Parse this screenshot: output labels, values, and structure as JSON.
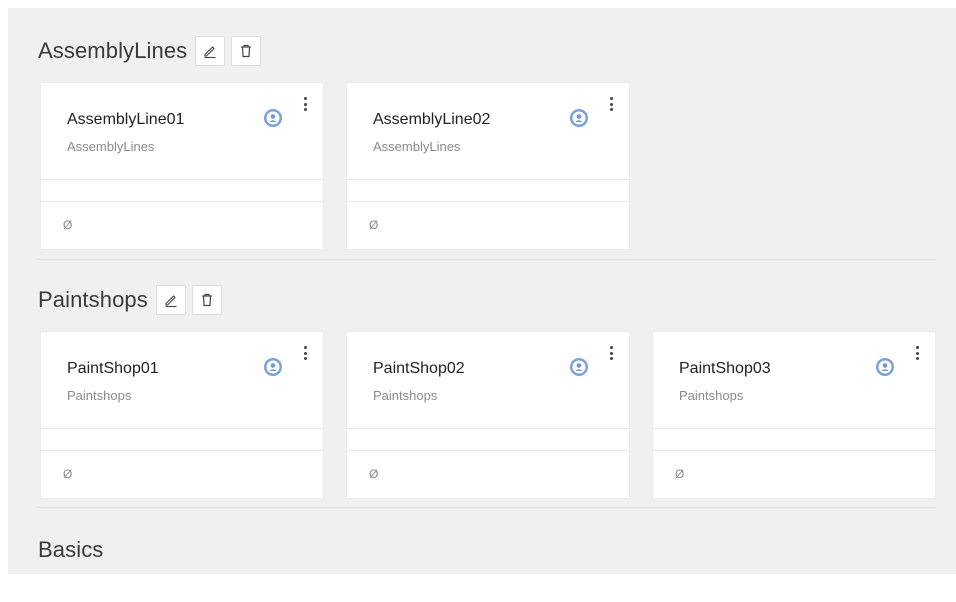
{
  "sections": [
    {
      "title": "AssemblyLines",
      "cards": [
        {
          "title": "AssemblyLine01",
          "subtitle": "AssemblyLines",
          "footer": "Ø"
        },
        {
          "title": "AssemblyLine02",
          "subtitle": "AssemblyLines",
          "footer": "Ø"
        }
      ]
    },
    {
      "title": "Paintshops",
      "cards": [
        {
          "title": "PaintShop01",
          "subtitle": "Paintshops",
          "footer": "Ø"
        },
        {
          "title": "PaintShop02",
          "subtitle": "Paintshops",
          "footer": "Ø"
        },
        {
          "title": "PaintShop03",
          "subtitle": "Paintshops",
          "footer": "Ø"
        }
      ]
    },
    {
      "title": "Basics",
      "cards": []
    }
  ],
  "icons": {
    "edit": "pencil-icon",
    "delete": "trash-icon",
    "avatar": "user-avatar-icon",
    "menu": "more-vertical-icon"
  },
  "colors": {
    "background": "#f0f0f0",
    "card": "#ffffff",
    "avatar_accent": "#6f97d6"
  }
}
